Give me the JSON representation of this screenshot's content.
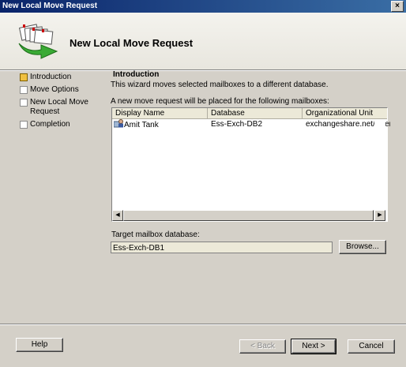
{
  "window": {
    "title": "New Local Move Request",
    "close_glyph": "×"
  },
  "banner": {
    "title": "New Local Move Request",
    "icon": "move-mailbox-wizard-icon"
  },
  "nav": {
    "items": [
      {
        "label": "Introduction",
        "active": true
      },
      {
        "label": "Move Options",
        "active": false
      },
      {
        "label": "New Local Move Request",
        "active": false
      },
      {
        "label": "Completion",
        "active": false
      }
    ]
  },
  "page": {
    "section_title": "Introduction",
    "description": "This wizard moves selected mailboxes to a different database.",
    "list_caption": "A new move request will be placed for the following mailboxes:"
  },
  "mailbox_list": {
    "columns": [
      "Display Name",
      "Database",
      "Organizational Unit"
    ],
    "rows": [
      {
        "display_name": "Amit Tank",
        "database": "Ess-Exch-DB2",
        "organizational_unit": "exchangeshare.net/Users"
      }
    ]
  },
  "target": {
    "label": "Target mailbox database:",
    "value": "Ess-Exch-DB1",
    "browse_label": "Browse..."
  },
  "buttons": {
    "help": "Help",
    "back": "< Back",
    "next": "Next >",
    "cancel": "Cancel"
  },
  "colors": {
    "titlebar_start": "#0a246a",
    "titlebar_end": "#3a6ea5",
    "dialog_bg": "#d4d0c8",
    "active_step": "#f0c040"
  }
}
